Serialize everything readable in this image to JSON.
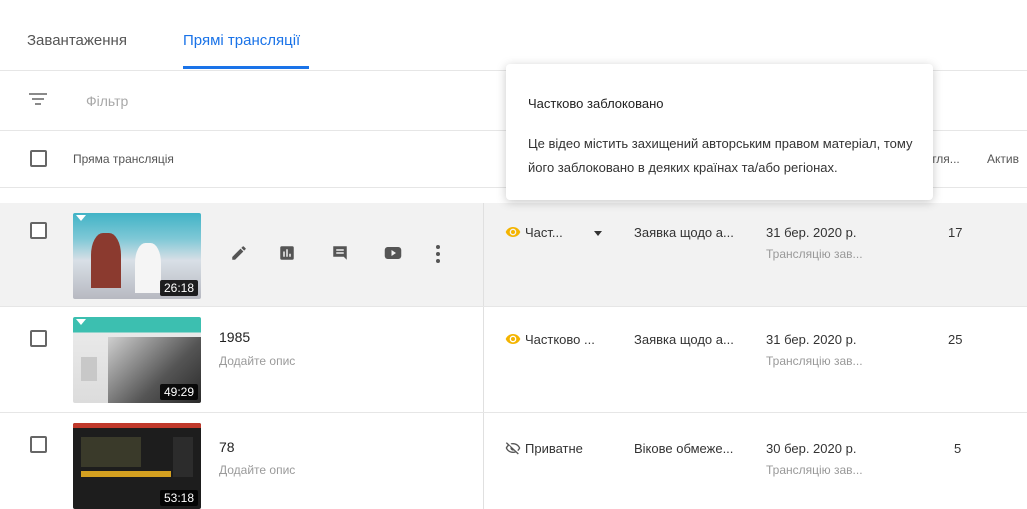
{
  "tabs": [
    {
      "label": "Завантаження"
    },
    {
      "label": "Прямі трансляції"
    }
  ],
  "filter": {
    "placeholder": "Фільтр"
  },
  "table": {
    "column_live": "Пряма трансляція",
    "column_views_truncated": "тля...",
    "column_active_truncated": "Актив"
  },
  "tooltip": {
    "title": "Частково заблоковано",
    "body": "Це відео містить захищений авторським правом матеріал, тому його заблоковано в деяких країнах та/або регіонах."
  },
  "row_actions": [
    "edit-icon",
    "analytics-icon",
    "comments-icon",
    "youtube-icon",
    "more-vert-icon"
  ],
  "rows": [
    {
      "title": "",
      "description": "",
      "duration": "26:18",
      "visibility": "Част...",
      "visibility_icon": "eye-icon",
      "restriction": "Заявка щодо а...",
      "date": "31 бер. 2020 р.",
      "date_sub": "Трансляцію зав...",
      "views": "17"
    },
    {
      "title": "1985",
      "description": "Додайте опис",
      "duration": "49:29",
      "visibility": "Частково ...",
      "visibility_icon": "eye-icon",
      "restriction": "Заявка щодо а...",
      "date": "31 бер. 2020 р.",
      "date_sub": "Трансляцію зав...",
      "views": "25"
    },
    {
      "title": "78",
      "description": "Додайте опис",
      "duration": "53:18",
      "visibility": "Приватне",
      "visibility_icon": "eye-off-icon",
      "restriction": "Вікове обмеже...",
      "date": "30 бер. 2020 р.",
      "date_sub": "Трансляцію зав...",
      "views": "5"
    }
  ],
  "colors": {
    "accent": "#1a73e8",
    "partial": "#f4b400",
    "hover_row": "#f2f2f2"
  }
}
